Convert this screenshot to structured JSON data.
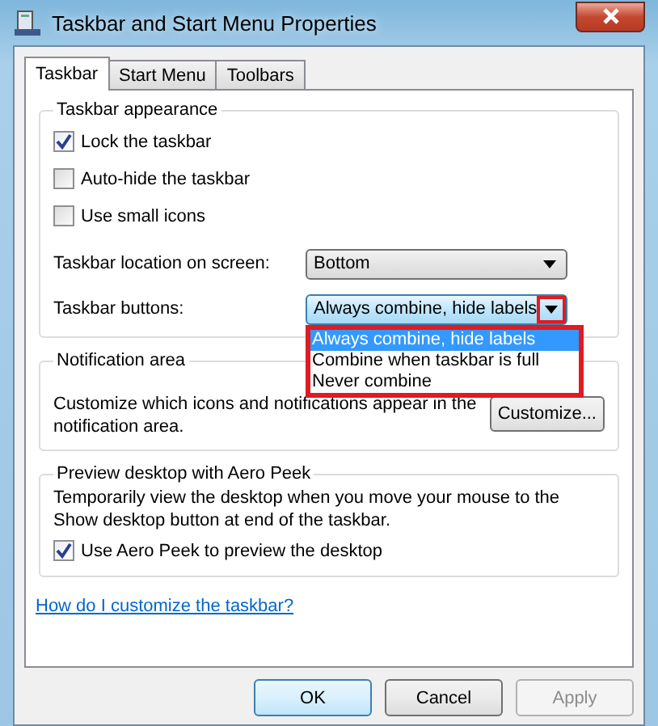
{
  "window": {
    "title": "Taskbar and Start Menu Properties"
  },
  "tabs": [
    {
      "label": "Taskbar",
      "selected": true
    },
    {
      "label": "Start Menu",
      "selected": false
    },
    {
      "label": "Toolbars",
      "selected": false
    }
  ],
  "appearance": {
    "title": "Taskbar appearance",
    "checkboxes": [
      {
        "label": "Lock the taskbar",
        "checked": true
      },
      {
        "label": "Auto-hide the taskbar",
        "checked": false
      },
      {
        "label": "Use small icons",
        "checked": false
      }
    ],
    "location": {
      "label": "Taskbar location on screen:",
      "value": "Bottom"
    },
    "buttons": {
      "label": "Taskbar buttons:",
      "value": "Always combine, hide labels",
      "expanded": true,
      "highlighted": true,
      "options": [
        {
          "label": "Always combine, hide labels",
          "selected": true
        },
        {
          "label": "Combine when taskbar is full",
          "selected": false
        },
        {
          "label": "Never combine",
          "selected": false
        }
      ]
    }
  },
  "notification": {
    "title": "Notification area",
    "text": "Customize which icons and notifications appear in the notification area.",
    "button": "Customize..."
  },
  "peek": {
    "title": "Preview desktop with Aero Peek",
    "text": "Temporarily view the desktop when you move your mouse to the Show desktop button at end of the taskbar.",
    "checkbox": {
      "label": "Use Aero Peek to preview the desktop",
      "checked": true
    }
  },
  "help_link": "How do I customize the taskbar?",
  "footer_buttons": [
    {
      "label": "OK",
      "disabled": false,
      "default": true
    },
    {
      "label": "Cancel",
      "disabled": false,
      "default": false
    },
    {
      "label": "Apply",
      "disabled": true,
      "default": false
    }
  ]
}
